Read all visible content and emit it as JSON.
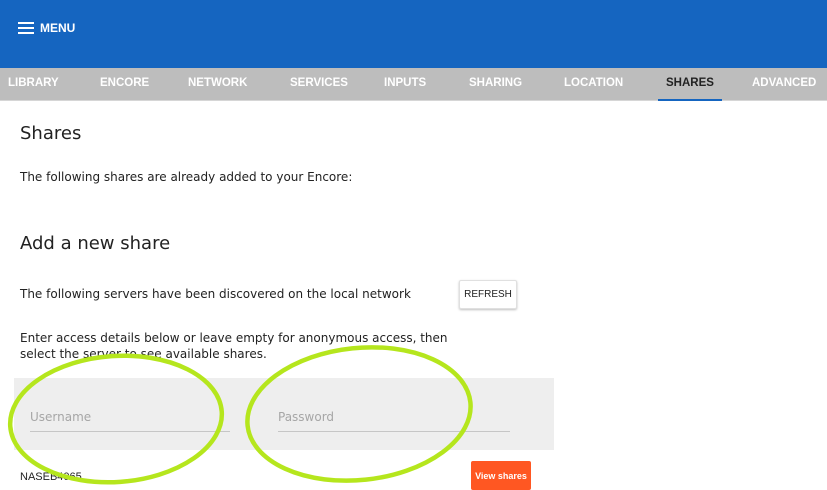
{
  "header": {
    "menu_label": "MENU",
    "brand_color": "#1565c0"
  },
  "tabs": [
    {
      "label": "LIBRARY"
    },
    {
      "label": "ENCORE"
    },
    {
      "label": "NETWORK"
    },
    {
      "label": "SERVICES"
    },
    {
      "label": "INPUTS"
    },
    {
      "label": "SHARING"
    },
    {
      "label": "LOCATION"
    },
    {
      "label": "SHARES",
      "active": true
    },
    {
      "label": "ADVANCED"
    }
  ],
  "shares": {
    "title": "Shares",
    "existing_text": "The following shares are already added to your Encore:"
  },
  "add_share": {
    "title": "Add a new share",
    "discovered_text": "The following servers have been discovered on the local network",
    "refresh_label": "REFRESH",
    "access_text": "Enter access details below or leave empty for anonymous access, then select the server to see available shares.",
    "username_placeholder": "Username",
    "password_placeholder": "Password",
    "servers": [
      {
        "name": "NASEB4065",
        "button_label": "View shares"
      }
    ],
    "view_button_color": "#ff5722"
  },
  "annotation_color": "#b5e61d"
}
